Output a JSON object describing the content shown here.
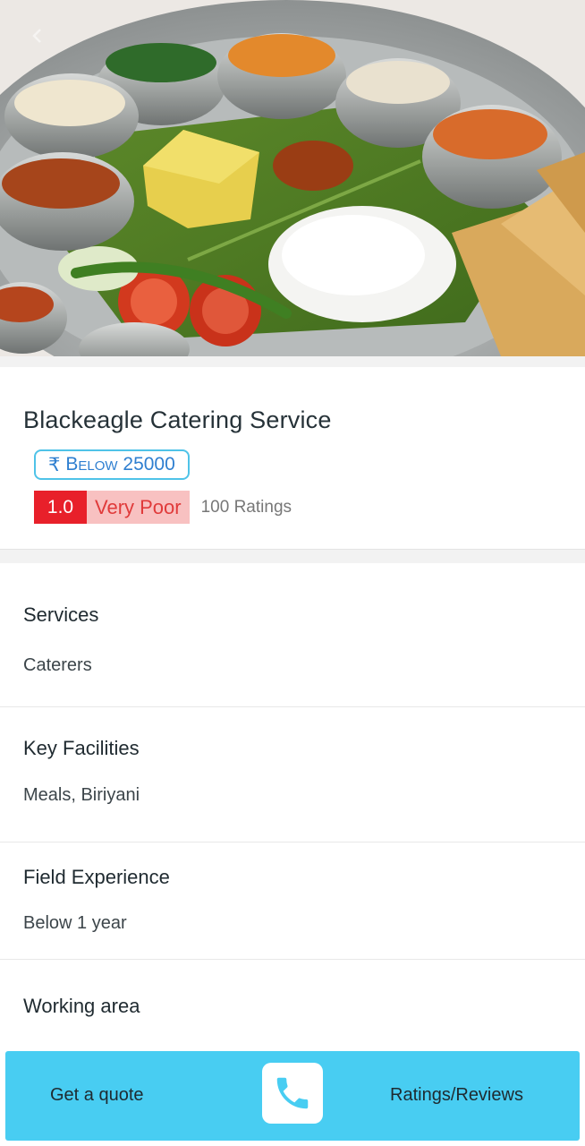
{
  "listing": {
    "title": "Blackeagle Catering Service",
    "price_symbol": "₹",
    "price_label": "Below 25000",
    "rating_score": "1.0",
    "rating_label": "Very Poor",
    "rating_count": "100 Ratings"
  },
  "sections": {
    "services": {
      "title": "Services",
      "value": "Caterers"
    },
    "key_facilities": {
      "title": "Key Facilities",
      "value": "Meals, Biriyani"
    },
    "field_experience": {
      "title": "Field Experience",
      "value": "Below 1 year"
    },
    "working_area": {
      "title": "Working area"
    }
  },
  "actions": {
    "quote_label": "Get a quote",
    "call_icon": "phone-icon",
    "reviews_label": "Ratings/Reviews"
  },
  "colors": {
    "accent": "#48cdf2",
    "rating_bad": "#e8202a",
    "rating_bad_bg": "#f8c1c1",
    "price_border": "#4fc3e8"
  },
  "icons": {
    "back": "back-arrow-icon"
  }
}
